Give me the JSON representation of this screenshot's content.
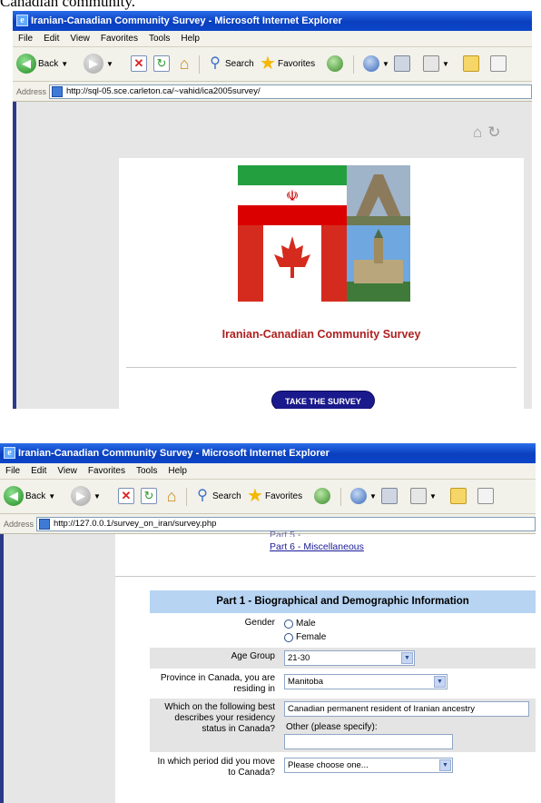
{
  "caption": "Canadian community.",
  "window1": {
    "title": "Iranian-Canadian Community Survey - Microsoft Internet Explorer",
    "menu": [
      "File",
      "Edit",
      "View",
      "Favorites",
      "Tools",
      "Help"
    ],
    "toolbar": {
      "back": "Back",
      "search": "Search",
      "favorites": "Favorites"
    },
    "address_label": "Address",
    "url": "http://sql-05.sce.carleton.ca/~vahid/ica2005survey/",
    "survey_title": "Iranian-Canadian Community Survey",
    "take_survey": "TAKE THE SURVEY"
  },
  "window2": {
    "title": "Iranian-Canadian Community Survey - Microsoft Internet Explorer",
    "menu": [
      "File",
      "Edit",
      "View",
      "Favorites",
      "Tools",
      "Help"
    ],
    "toolbar": {
      "back": "Back",
      "search": "Search",
      "favorites": "Favorites"
    },
    "address_label": "Address",
    "url": "http://127.0.0.1/survey_on_iran/survey.php",
    "nav_part6": "Part 6 - Miscellaneous",
    "part_header": "Part 1 - Biographical and Demographic Information",
    "gender_label": "Gender",
    "gender_options": [
      "Male",
      "Female"
    ],
    "age_label": "Age Group",
    "age_value": "21-30",
    "province_label": "Province in Canada, you are residing in",
    "province_value": "Manitoba",
    "residency_label": "Which on the following best describes your residency status in Canada?",
    "residency_value": "Canadian permanent resident of Iranian ancestry",
    "other_label": "Other (please specify):",
    "period_label": "In which period did you move to Canada?",
    "period_value": "Please choose one..."
  }
}
